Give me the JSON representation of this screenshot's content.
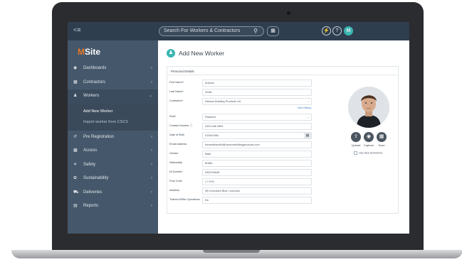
{
  "topbar": {
    "menu_icon": "menu-icon",
    "search_placeholder": "Search For Workers & Contractors",
    "user_initial": "M"
  },
  "sidebar": {
    "logo_text": "Site",
    "logo_letter": "M",
    "items": [
      {
        "label": "Dashboards",
        "icon": "dashboard-icon"
      },
      {
        "label": "Contractors",
        "icon": "building-icon"
      },
      {
        "label": "Workers",
        "icon": "person-icon"
      },
      {
        "label": "Pre Registration",
        "icon": "link-icon"
      },
      {
        "label": "Access",
        "icon": "door-icon"
      },
      {
        "label": "Safety",
        "icon": "safety-icon"
      },
      {
        "label": "Sustainability",
        "icon": "leaf-icon"
      },
      {
        "label": "Deliveries",
        "icon": "truck-icon"
      },
      {
        "label": "Reports",
        "icon": "report-icon"
      }
    ],
    "sub_items": [
      "Add New Worker",
      "Import worker from CSCS"
    ]
  },
  "main": {
    "title": "Add New Worker",
    "section_title": "Personal Details",
    "view_history": "View History",
    "fields": [
      {
        "label": "First Name*",
        "value": "Antonio"
      },
      {
        "label": "Last Name*",
        "value": "Smith"
      },
      {
        "label": "Contractor*",
        "value": "Hanson Building Products Ltd"
      },
      {
        "label": "Role*",
        "value": "Plasterer"
      },
      {
        "label": "Contact Number ⓘ",
        "value": "0203 456 2893"
      },
      {
        "label": "Date of Birth",
        "value": "01/06/1984"
      },
      {
        "label": "Email Address",
        "value": "hnnsmithsmith@hansonbuildingproducts.com"
      },
      {
        "label": "Gender",
        "value": "Male"
      },
      {
        "label": "Nationality",
        "value": "British"
      },
      {
        "label": "NI Number",
        "value": "NS2234648"
      },
      {
        "label": "Post Code",
        "value": "L7 9YN"
      },
      {
        "label": "Address",
        "value": "35 Innovation Blvd, Liverpool"
      },
      {
        "label": "Trained MSite Operatives",
        "value": "No"
      }
    ],
    "photo_actions": {
      "upload": "Upload",
      "capture": "Capture",
      "scan": "Scan"
    },
    "face_biometrics": "Use face biometrics"
  },
  "colors": {
    "topbar": "#2f3e4f",
    "sidebar": "#45586b",
    "accent": "#3bb6b1",
    "logo_accent": "#e8782a"
  }
}
